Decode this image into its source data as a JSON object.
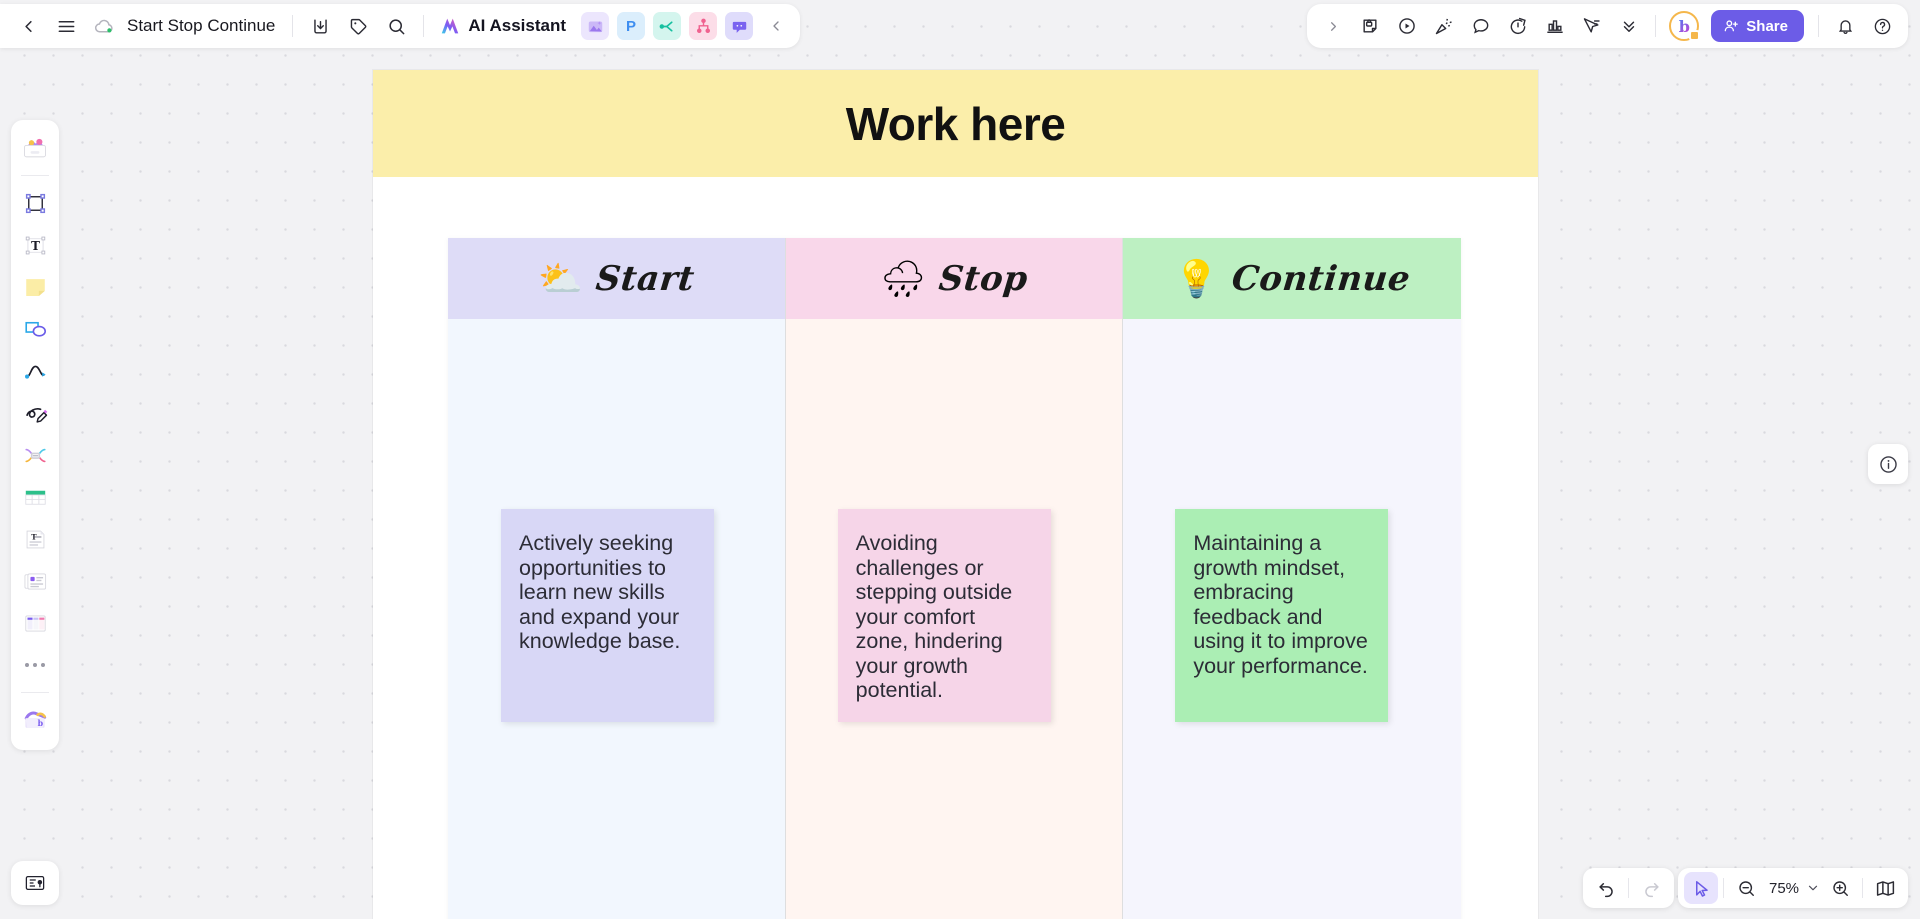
{
  "app": {
    "board_name": "Start Stop Continue",
    "ai_assistant_label": "AI Assistant",
    "share_label": "Share",
    "zoom_level": "75%"
  },
  "topbar_left": {
    "back_icon": "chevron-left-icon",
    "menu_icon": "hamburger-menu-icon",
    "cloud_icon": "cloud-saved-icon",
    "export_icon": "export-download-icon",
    "tag_icon": "tag-icon",
    "search_icon": "search-icon",
    "ai_icon": "ai-sparkle-icon",
    "mini_apps": [
      {
        "name": "image-generator",
        "glyph": "",
        "cls": "ma-img"
      },
      {
        "name": "presentation",
        "glyph": "P",
        "cls": "ma-p"
      },
      {
        "name": "flowchart",
        "glyph": "",
        "cls": "ma-flow"
      },
      {
        "name": "mindmap",
        "glyph": "",
        "cls": "ma-mind"
      },
      {
        "name": "chat",
        "glyph": "",
        "cls": "ma-chat"
      }
    ],
    "collapse_icon": "chevron-left-icon"
  },
  "topbar_right": {
    "expand_icon": "chevron-right-icon",
    "items": [
      "sticky-note-lock-icon",
      "play-circle-icon",
      "celebrate-icon",
      "comment-icon",
      "timer-icon",
      "vote-chart-icon",
      "cursor-flag-icon",
      "chevrons-down-icon"
    ],
    "notification_icon": "bell-icon",
    "help_icon": "help-circle-icon",
    "avatar_initial": "b"
  },
  "rail": {
    "items": [
      {
        "name": "templates-tool",
        "label": "Templates"
      },
      {
        "name": "frame-tool",
        "label": "Frame"
      },
      {
        "name": "text-tool",
        "label": "Text"
      },
      {
        "name": "sticky-note-tool",
        "label": "Sticky note"
      },
      {
        "name": "shapes-tool",
        "label": "Shapes"
      },
      {
        "name": "connector-tool",
        "label": "Connector line"
      },
      {
        "name": "pen-tool",
        "label": "Pen"
      },
      {
        "name": "mindmap-tool",
        "label": "Mind map"
      },
      {
        "name": "table-tool",
        "label": "Table"
      },
      {
        "name": "document-tool",
        "label": "Document"
      },
      {
        "name": "card-tool",
        "label": "Cards"
      },
      {
        "name": "kanban-tool",
        "label": "Kanban"
      },
      {
        "name": "more-tools",
        "label": "More"
      },
      {
        "name": "ai-tool",
        "label": "AI tools"
      }
    ],
    "bottom_item": {
      "name": "presentation-mode",
      "label": "Presentation"
    }
  },
  "canvas": {
    "info_icon": "info-circle-icon",
    "frame": {
      "title": "Work here"
    },
    "columns": [
      {
        "id": "start",
        "emoji": "⛅",
        "emoji_name": "sun-behind-cloud-icon",
        "title": "Start",
        "header_color": "#dedcf7",
        "body_color": "#f2f7fe",
        "note": {
          "text": "Actively seeking opportunities to learn new skills and expand your knowledge base.",
          "color": "#d8d7f6"
        }
      },
      {
        "id": "stop",
        "emoji": "🌧",
        "emoji_name": "rain-cloud-icon",
        "title": "Stop",
        "header_color": "#f9d7ea",
        "body_color": "#fff5f1",
        "note": {
          "text": "Avoiding challenges or stepping outside your comfort zone, hindering your growth potential.",
          "color": "#f6d5e8"
        }
      },
      {
        "id": "continue",
        "emoji": "💡",
        "emoji_name": "light-bulb-icon",
        "title": "Continue",
        "header_color": "#bdf0c2",
        "body_color": "#f5f5fd",
        "note": {
          "text": "Maintaining a growth mindset, embracing feedback and using it to improve your performance.",
          "color": "#abeeb4"
        }
      }
    ]
  },
  "bottom": {
    "undo_icon": "undo-icon",
    "redo_icon": "redo-icon",
    "cursor_icon": "cursor-select-icon",
    "zoom_out_icon": "zoom-out-icon",
    "zoom_in_icon": "zoom-in-icon",
    "zoom_dropdown_icon": "chevron-down-icon",
    "minimap_icon": "minimap-icon"
  },
  "colors": {
    "accent": "#6c5ce7",
    "frame_title_bg": "#fbeeaa",
    "canvas_bg": "#f2f2f4"
  }
}
